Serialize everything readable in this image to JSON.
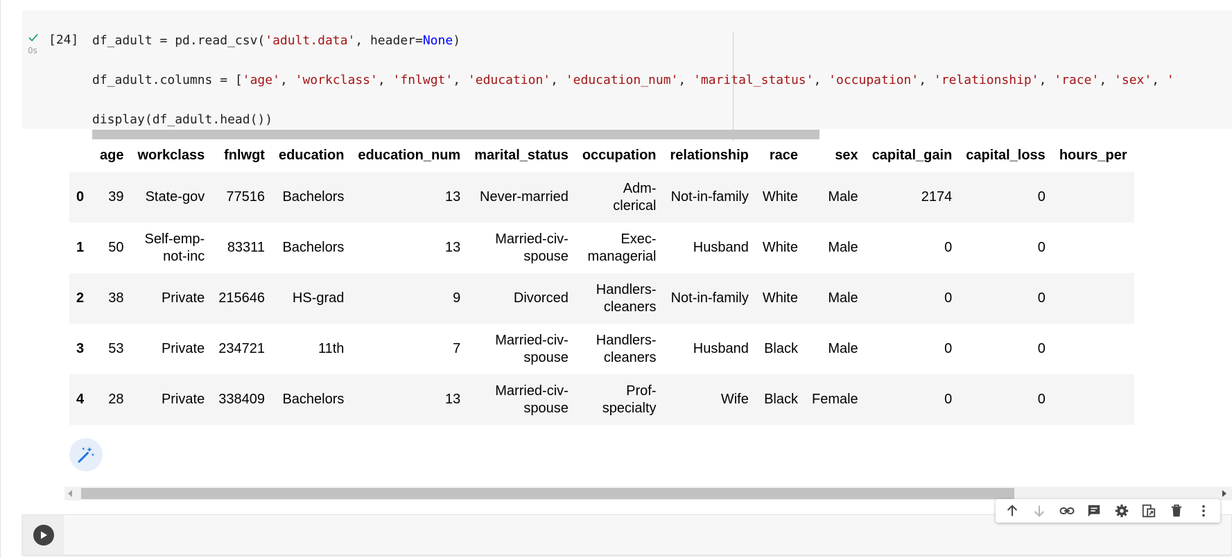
{
  "code_cell": {
    "exec_count": "[24]",
    "exec_time": "0s",
    "status_icon": "check-icon",
    "lines": [
      [
        {
          "t": "df_adult = pd.read_csv(",
          "c": ""
        },
        {
          "t": "'adult.data'",
          "c": "str"
        },
        {
          "t": ", header=",
          "c": ""
        },
        {
          "t": "None",
          "c": "kw"
        },
        {
          "t": ")",
          "c": ""
        }
      ],
      [
        {
          "t": "df_adult.columns = [",
          "c": ""
        },
        {
          "t": "'age'",
          "c": "str"
        },
        {
          "t": ", ",
          "c": ""
        },
        {
          "t": "'workclass'",
          "c": "str"
        },
        {
          "t": ", ",
          "c": ""
        },
        {
          "t": "'fnlwgt'",
          "c": "str"
        },
        {
          "t": ", ",
          "c": ""
        },
        {
          "t": "'education'",
          "c": "str"
        },
        {
          "t": ", ",
          "c": ""
        },
        {
          "t": "'education_num'",
          "c": "str"
        },
        {
          "t": ", ",
          "c": ""
        },
        {
          "t": "'marital_status'",
          "c": "str"
        },
        {
          "t": ", ",
          "c": ""
        },
        {
          "t": "'occupation'",
          "c": "str"
        },
        {
          "t": ", ",
          "c": ""
        },
        {
          "t": "'relationship'",
          "c": "str"
        },
        {
          "t": ", ",
          "c": ""
        },
        {
          "t": "'race'",
          "c": "str"
        },
        {
          "t": ", ",
          "c": ""
        },
        {
          "t": "'sex'",
          "c": "str"
        },
        {
          "t": ", ",
          "c": ""
        },
        {
          "t": "'",
          "c": "str"
        }
      ],
      [
        {
          "t": "display(df_adult.head())",
          "c": ""
        }
      ]
    ]
  },
  "output_table": {
    "columns": [
      "age",
      "workclass",
      "fnlwgt",
      "education",
      "education_num",
      "marital_status",
      "occupation",
      "relationship",
      "race",
      "sex",
      "capital_gain",
      "capital_loss",
      "hours_per"
    ],
    "wrap_columns": [
      1,
      5,
      6
    ],
    "rows": [
      {
        "index": "0",
        "cells": [
          "39",
          "State-gov",
          "77516",
          "Bachelors",
          "13",
          "Never-married",
          "Adm-clerical",
          "Not-in-family",
          "White",
          "Male",
          "2174",
          "0",
          ""
        ]
      },
      {
        "index": "1",
        "cells": [
          "50",
          "Self-emp-not-inc",
          "83311",
          "Bachelors",
          "13",
          "Married-civ-spouse",
          "Exec-managerial",
          "Husband",
          "White",
          "Male",
          "0",
          "0",
          ""
        ]
      },
      {
        "index": "2",
        "cells": [
          "38",
          "Private",
          "215646",
          "HS-grad",
          "9",
          "Divorced",
          "Handlers-cleaners",
          "Not-in-family",
          "White",
          "Male",
          "0",
          "0",
          ""
        ]
      },
      {
        "index": "3",
        "cells": [
          "53",
          "Private",
          "234721",
          "11th",
          "7",
          "Married-civ-spouse",
          "Handlers-cleaners",
          "Husband",
          "Black",
          "Male",
          "0",
          "0",
          ""
        ]
      },
      {
        "index": "4",
        "cells": [
          "28",
          "Private",
          "338409",
          "Bachelors",
          "13",
          "Married-civ-spouse",
          "Prof-specialty",
          "Wife",
          "Black",
          "Female",
          "0",
          "0",
          ""
        ]
      }
    ]
  },
  "output_actions": {
    "wand_icon": "magic-wand-icon"
  },
  "scrollbar": {
    "left_icon": "scroll-left-arrow-icon",
    "right_icon": "scroll-right-arrow-icon"
  },
  "next_cell": {
    "run_icon": "play-icon"
  },
  "cell_toolbar": {
    "buttons": [
      {
        "name": "move-up-button",
        "icon": "arrow-up-icon"
      },
      {
        "name": "move-down-button",
        "icon": "arrow-down-icon"
      },
      {
        "name": "copy-link-button",
        "icon": "link-icon"
      },
      {
        "name": "add-comment-button",
        "icon": "comment-icon"
      },
      {
        "name": "cell-settings-button",
        "icon": "gear-icon"
      },
      {
        "name": "mirror-cell-button",
        "icon": "mirror-icon"
      },
      {
        "name": "delete-cell-button",
        "icon": "trash-icon"
      },
      {
        "name": "more-actions-button",
        "icon": "more-vert-icon"
      }
    ]
  },
  "colors": {
    "string": "#a31515",
    "keyword": "#0000ff",
    "check": "#0f9d58",
    "wand": "#1a73e8"
  }
}
